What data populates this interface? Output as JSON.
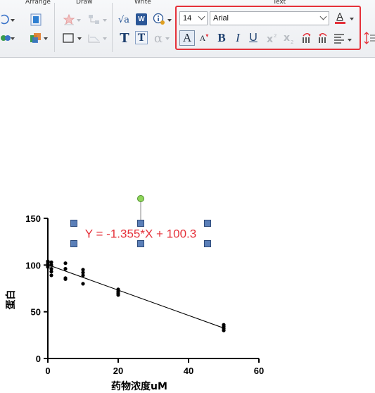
{
  "ribbon": {
    "groups": {
      "arrange": "Arrange",
      "draw": "Draw",
      "write": "Write",
      "text": "Text"
    },
    "text_format": {
      "font_size": "14",
      "font_family": "Arial",
      "bold_label": "B",
      "italic_label": "I",
      "underline_label": "U",
      "big_a_label": "A",
      "small_a_label": "A",
      "font_color_label": "A",
      "font_color": "#e5313a"
    },
    "write": {
      "sqrt_label": "√a",
      "word_label": "W",
      "text_t_label": "T",
      "boxed_t_label": "T",
      "alpha_label": "α"
    }
  },
  "chart_data": {
    "type": "scatter",
    "xlabel": "药物浓度uM",
    "ylabel": "蛋白",
    "xlim": [
      0,
      60
    ],
    "ylim": [
      0,
      150
    ],
    "xticks": [
      "0",
      "20",
      "40",
      "60"
    ],
    "yticks": [
      "0",
      "50",
      "100",
      "150"
    ],
    "points": [
      {
        "x": 0,
        "y": 100
      },
      {
        "x": 0,
        "y": 102
      },
      {
        "x": 0,
        "y": 98
      },
      {
        "x": 0,
        "y": 104
      },
      {
        "x": 1,
        "y": 103
      },
      {
        "x": 1,
        "y": 100
      },
      {
        "x": 1,
        "y": 96
      },
      {
        "x": 1,
        "y": 93
      },
      {
        "x": 1,
        "y": 89
      },
      {
        "x": 5,
        "y": 102
      },
      {
        "x": 5,
        "y": 96
      },
      {
        "x": 5,
        "y": 86
      },
      {
        "x": 5,
        "y": 85
      },
      {
        "x": 10,
        "y": 95
      },
      {
        "x": 10,
        "y": 92
      },
      {
        "x": 10,
        "y": 89
      },
      {
        "x": 10,
        "y": 80
      },
      {
        "x": 20,
        "y": 74
      },
      {
        "x": 20,
        "y": 72
      },
      {
        "x": 20,
        "y": 70
      },
      {
        "x": 20,
        "y": 68
      },
      {
        "x": 50,
        "y": 36
      },
      {
        "x": 50,
        "y": 34
      },
      {
        "x": 50,
        "y": 32
      },
      {
        "x": 50,
        "y": 30
      }
    ],
    "fit_line": {
      "slope": -1.355,
      "intercept": 100.3,
      "x_range": [
        0,
        50
      ]
    },
    "equation_label": "Y = -1.355*X + 100.3",
    "equation_color": "#e5313a",
    "grid": false
  }
}
